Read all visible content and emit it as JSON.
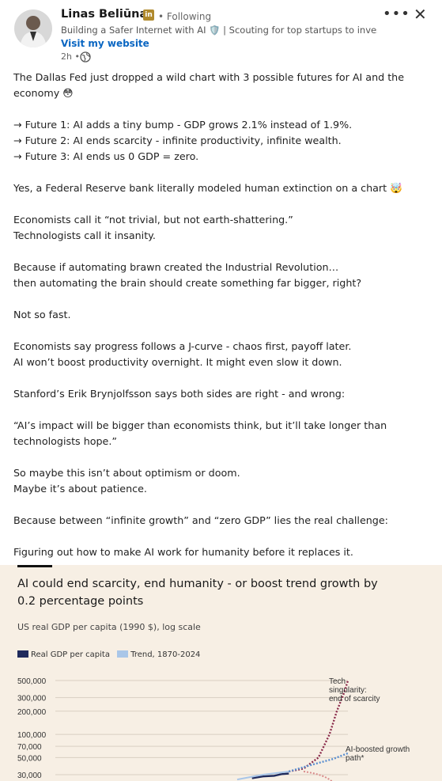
{
  "author": {
    "name": "Linas Beliūnas",
    "badge": "in",
    "status": "• Following",
    "headline": "Building a Safer Internet with AI 🛡️ | Scouting for top startups to invest…",
    "website_link": "Visit my website",
    "time": "2h •"
  },
  "icons": {
    "more": "more-options-icon",
    "close": "close-icon",
    "visibility": "globe-icon"
  },
  "post": {
    "paragraphs": [
      "The Dallas Fed just dropped a wild chart with 3 possible futures for AI and the economy 😳",
      "→ Future 1: AI adds a tiny bump - GDP grows 2.1% instead of 1.9%.\n→ Future 2: AI ends scarcity - infinite productivity, infinite wealth.\n→ Future 3: AI ends us 0 GDP = zero.",
      "Yes, a Federal Reserve bank literally modeled human extinction on a chart 🤯",
      "Economists call it “not trivial, but not earth-shattering.”\nTechnologists call it insanity.",
      "Because if automating brawn created the Industrial Revolution…\nthen automating the brain should create something far bigger, right?",
      "Not so fast.",
      "Economists say progress follows a J-curve - chaos first, payoff later.\nAI won’t boost productivity overnight. It might even slow it down.",
      "Stanford’s Erik Brynjolfsson says both sides are right - and wrong:",
      "“AI’s impact will be bigger than economists think, but it’ll take longer than technologists hope.”",
      "So maybe this isn’t about optimism or doom.\nMaybe it’s about patience.",
      "Because between “infinite growth” and “zero GDP” lies the real challenge:",
      "Figuring out how to make AI work for humanity before it replaces it."
    ]
  },
  "colors": {
    "link": "#0a66c2",
    "chart_bg": "#f7efe4",
    "series_real": "#1f2a5c",
    "series_trend": "#a9c6e8",
    "singularity": "#8a2a4a",
    "boosted": "#5a8fd0",
    "extinction": "#d98a8a"
  },
  "chart_data": {
    "type": "line",
    "title": "AI could end scarcity, end humanity - or boost trend growth by 0.2 percentage points",
    "subtitle": "US real GDP per capita (1990 $), log scale",
    "legend": [
      "Real GDP per capita",
      "Trend, 1870-2024"
    ],
    "y_ticks": [
      "500,000",
      "300,000",
      "200,000",
      "100,000",
      "70,000",
      "50,000",
      "30,000"
    ],
    "y_scale": "log",
    "grid": true,
    "annotations": [
      "Tech singularity: end of scarcity",
      "AI-boosted growth path*"
    ],
    "series": [
      {
        "name": "Real GDP per capita",
        "x": [
          2014,
          2017,
          2020,
          2022,
          2024
        ],
        "y": [
          27000,
          28500,
          29000,
          30500,
          31000
        ]
      },
      {
        "name": "Trend, 1870-2024",
        "x": [
          2010,
          2017,
          2024
        ],
        "y": [
          26000,
          30000,
          33000
        ]
      },
      {
        "name": "Tech singularity: end of scarcity",
        "x": [
          2024,
          2028,
          2032,
          2035,
          2037,
          2039,
          2040
        ],
        "y": [
          33000,
          36000,
          50000,
          100000,
          200000,
          350000,
          500000
        ]
      },
      {
        "name": "AI-boosted growth path*",
        "x": [
          2024,
          2030,
          2036,
          2040
        ],
        "y": [
          33000,
          40000,
          48000,
          57000
        ]
      }
    ]
  }
}
